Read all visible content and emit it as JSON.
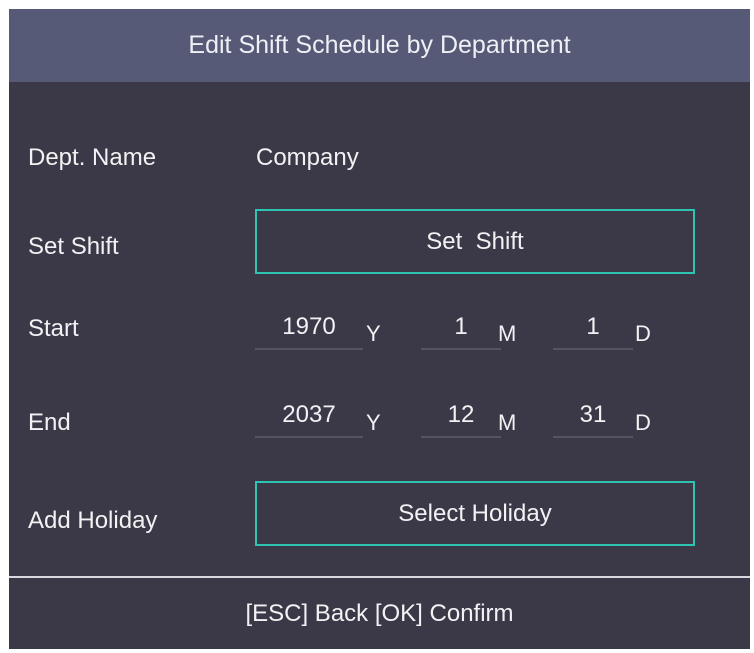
{
  "title": "Edit Shift Schedule by Department",
  "dept": {
    "label": "Dept. Name",
    "value": "Company"
  },
  "shift": {
    "label": "Set Shift",
    "button_label": "Set  Shift"
  },
  "start": {
    "label": "Start",
    "year": "1970",
    "month": "1",
    "day": "1"
  },
  "end": {
    "label": "End",
    "year": "2037",
    "month": "12",
    "day": "31"
  },
  "units": {
    "year": "Y",
    "month": "M",
    "day": "D"
  },
  "holiday": {
    "label": "Add Holiday",
    "button_label": "Select Holiday"
  },
  "footer": {
    "hint": "[ESC] Back [OK] Confirm"
  },
  "colors": {
    "background": "#3b3947",
    "title_bar": "#575a77",
    "accent_border": "#2ec4b2",
    "field_underline": "#545263"
  }
}
